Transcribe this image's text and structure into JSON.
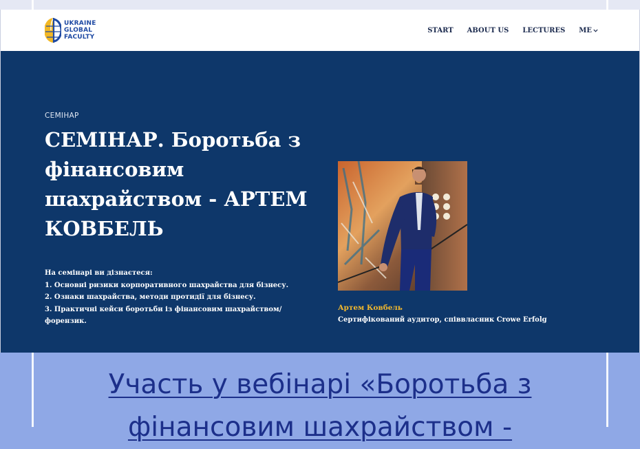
{
  "header": {
    "logo": {
      "line1": "UKRAINE",
      "line2": "GLOBAL",
      "line3": "FACULTY",
      "colors": {
        "blue": "#1f4aa3",
        "yellow": "#f3b824"
      }
    },
    "nav": {
      "items": [
        {
          "label": "START"
        },
        {
          "label": "ABOUT US"
        },
        {
          "label": "LECTURES"
        },
        {
          "label": "ME"
        }
      ]
    }
  },
  "hero": {
    "eyebrow": "СЕМІНАР",
    "title": "СЕМІНАР. Боротьба з фінансовим шахрайством - АРТЕМ КОВБЕЛЬ",
    "bullets": {
      "intro": "На семінарі ви дізнаєтеся:",
      "items": [
        "1. Основні ризики корпоративного шахрайства для бізнесу.",
        "2. Ознаки шахрайства, методи протидії для бізнесу.",
        "3. Практичні кейси боротьби із фінансовим шахрайством/ форензик."
      ]
    },
    "speaker": {
      "name": "Артем Ковбель",
      "role": "Сертифікований аудитор, співвласник Crowe Erfolg"
    },
    "colors": {
      "background": "#0e376a",
      "speaker_name": "#f2b82d"
    }
  },
  "cta": {
    "line1": "Участь у вебінарі «Боротьба з",
    "line2": "фінансовим шахрайством -"
  },
  "colors": {
    "page_background": "#8fa8e6",
    "link": "#1c2f8a"
  }
}
